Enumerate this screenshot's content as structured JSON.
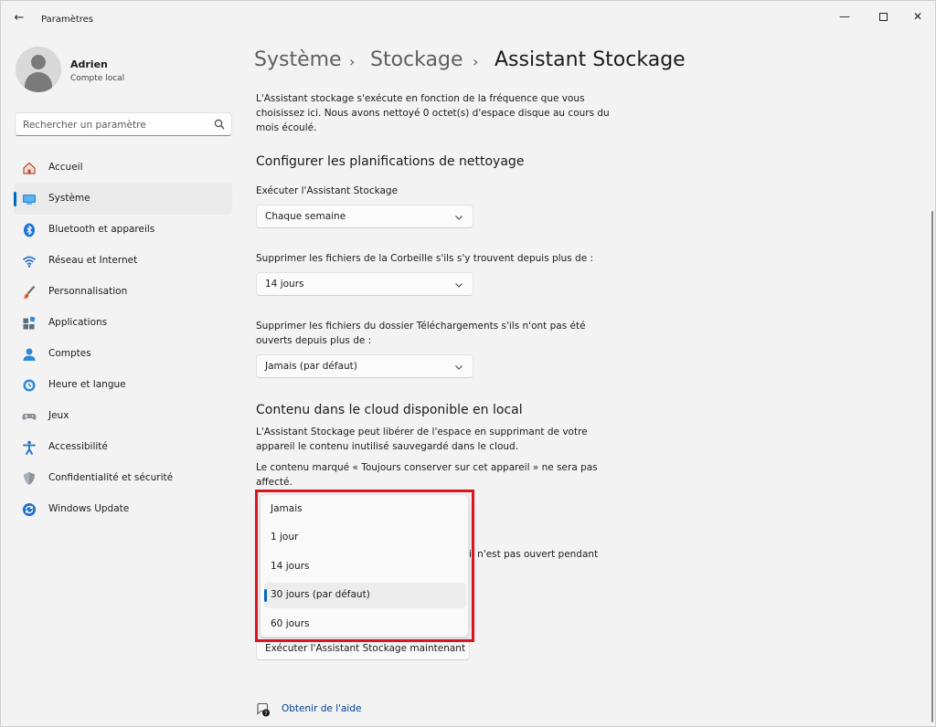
{
  "window": {
    "title": "Paramètres",
    "back_glyph": "←",
    "minimize_glyph": "—",
    "close_glyph": "✕"
  },
  "profile": {
    "name": "Adrien",
    "subtitle": "Compte local"
  },
  "search": {
    "placeholder": "Rechercher un paramètre"
  },
  "sidebar": {
    "items": [
      {
        "label": "Accueil",
        "icon": "home-icon"
      },
      {
        "label": "Système",
        "icon": "system-icon",
        "active": true
      },
      {
        "label": "Bluetooth et appareils",
        "icon": "bluetooth-icon"
      },
      {
        "label": "Réseau et Internet",
        "icon": "wifi-icon"
      },
      {
        "label": "Personnalisation",
        "icon": "brush-icon"
      },
      {
        "label": "Applications",
        "icon": "apps-icon"
      },
      {
        "label": "Comptes",
        "icon": "account-icon"
      },
      {
        "label": "Heure et langue",
        "icon": "clock-globe-icon"
      },
      {
        "label": "Jeux",
        "icon": "gamepad-icon"
      },
      {
        "label": "Accessibilité",
        "icon": "accessibility-icon"
      },
      {
        "label": "Confidentialité et sécurité",
        "icon": "shield-icon"
      },
      {
        "label": "Windows Update",
        "icon": "update-icon"
      }
    ]
  },
  "breadcrumb": {
    "items": [
      "Système",
      "Stockage",
      "Assistant Stockage"
    ],
    "separator": "›"
  },
  "main": {
    "intro": "L'Assistant stockage s'exécute en fonction de la fréquence que vous choisissez ici. Nous avons nettoyé 0 octet(s) d'espace disque au cours du mois écoulé.",
    "section1_title": "Configurer les planifications de nettoyage",
    "run_label": "Exécuter l'Assistant Stockage",
    "run_value": "Chaque semaine",
    "recycle_label": "Supprimer les fichiers de la Corbeille s'ils s'y trouvent depuis plus de :",
    "recycle_value": "14 jours",
    "downloads_label": "Supprimer les fichiers du dossier Téléchargements s'ils n'ont pas été ouverts depuis plus de :",
    "downloads_value": "Jamais (par défaut)",
    "section2_title": "Contenu dans le cloud disponible en local",
    "cloud_text": "L'Assistant Stockage peut libérer de l'espace en supprimant de votre appareil le contenu inutilisé sauvegardé dans le cloud.",
    "cloud_note": "Le contenu marqué « Toujours conserver sur cet appareil » ne sera pas affecté.",
    "partial_text": "il n'est pas ouvert pendant",
    "run_now_button": "Exécuter l'Assistant Stockage maintenant",
    "help_link": "Obtenir de l'aide"
  },
  "dropdown": {
    "options": [
      "Jamais",
      "1 jour",
      "14 jours",
      "30 jours (par défaut)",
      "60 jours"
    ],
    "selected_index": 3
  },
  "colors": {
    "accent": "#0067c0",
    "highlight": "#d9161f",
    "link": "#003e92"
  }
}
